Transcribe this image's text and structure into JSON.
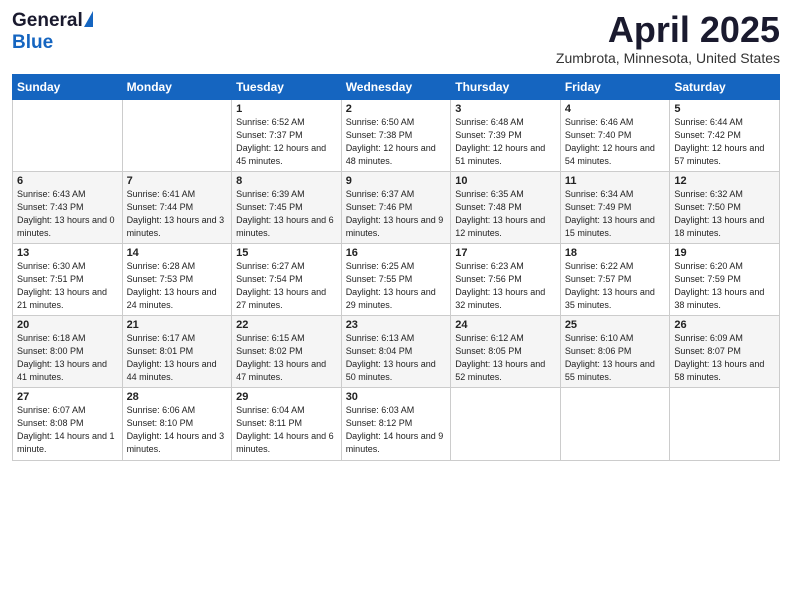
{
  "logo": {
    "general": "General",
    "blue": "Blue"
  },
  "title": "April 2025",
  "subtitle": "Zumbrota, Minnesota, United States",
  "weekdays": [
    "Sunday",
    "Monday",
    "Tuesday",
    "Wednesday",
    "Thursday",
    "Friday",
    "Saturday"
  ],
  "weeks": [
    [
      {
        "day": "",
        "sunrise": "",
        "sunset": "",
        "daylight": ""
      },
      {
        "day": "",
        "sunrise": "",
        "sunset": "",
        "daylight": ""
      },
      {
        "day": "1",
        "sunrise": "Sunrise: 6:52 AM",
        "sunset": "Sunset: 7:37 PM",
        "daylight": "Daylight: 12 hours and 45 minutes."
      },
      {
        "day": "2",
        "sunrise": "Sunrise: 6:50 AM",
        "sunset": "Sunset: 7:38 PM",
        "daylight": "Daylight: 12 hours and 48 minutes."
      },
      {
        "day": "3",
        "sunrise": "Sunrise: 6:48 AM",
        "sunset": "Sunset: 7:39 PM",
        "daylight": "Daylight: 12 hours and 51 minutes."
      },
      {
        "day": "4",
        "sunrise": "Sunrise: 6:46 AM",
        "sunset": "Sunset: 7:40 PM",
        "daylight": "Daylight: 12 hours and 54 minutes."
      },
      {
        "day": "5",
        "sunrise": "Sunrise: 6:44 AM",
        "sunset": "Sunset: 7:42 PM",
        "daylight": "Daylight: 12 hours and 57 minutes."
      }
    ],
    [
      {
        "day": "6",
        "sunrise": "Sunrise: 6:43 AM",
        "sunset": "Sunset: 7:43 PM",
        "daylight": "Daylight: 13 hours and 0 minutes."
      },
      {
        "day": "7",
        "sunrise": "Sunrise: 6:41 AM",
        "sunset": "Sunset: 7:44 PM",
        "daylight": "Daylight: 13 hours and 3 minutes."
      },
      {
        "day": "8",
        "sunrise": "Sunrise: 6:39 AM",
        "sunset": "Sunset: 7:45 PM",
        "daylight": "Daylight: 13 hours and 6 minutes."
      },
      {
        "day": "9",
        "sunrise": "Sunrise: 6:37 AM",
        "sunset": "Sunset: 7:46 PM",
        "daylight": "Daylight: 13 hours and 9 minutes."
      },
      {
        "day": "10",
        "sunrise": "Sunrise: 6:35 AM",
        "sunset": "Sunset: 7:48 PM",
        "daylight": "Daylight: 13 hours and 12 minutes."
      },
      {
        "day": "11",
        "sunrise": "Sunrise: 6:34 AM",
        "sunset": "Sunset: 7:49 PM",
        "daylight": "Daylight: 13 hours and 15 minutes."
      },
      {
        "day": "12",
        "sunrise": "Sunrise: 6:32 AM",
        "sunset": "Sunset: 7:50 PM",
        "daylight": "Daylight: 13 hours and 18 minutes."
      }
    ],
    [
      {
        "day": "13",
        "sunrise": "Sunrise: 6:30 AM",
        "sunset": "Sunset: 7:51 PM",
        "daylight": "Daylight: 13 hours and 21 minutes."
      },
      {
        "day": "14",
        "sunrise": "Sunrise: 6:28 AM",
        "sunset": "Sunset: 7:53 PM",
        "daylight": "Daylight: 13 hours and 24 minutes."
      },
      {
        "day": "15",
        "sunrise": "Sunrise: 6:27 AM",
        "sunset": "Sunset: 7:54 PM",
        "daylight": "Daylight: 13 hours and 27 minutes."
      },
      {
        "day": "16",
        "sunrise": "Sunrise: 6:25 AM",
        "sunset": "Sunset: 7:55 PM",
        "daylight": "Daylight: 13 hours and 29 minutes."
      },
      {
        "day": "17",
        "sunrise": "Sunrise: 6:23 AM",
        "sunset": "Sunset: 7:56 PM",
        "daylight": "Daylight: 13 hours and 32 minutes."
      },
      {
        "day": "18",
        "sunrise": "Sunrise: 6:22 AM",
        "sunset": "Sunset: 7:57 PM",
        "daylight": "Daylight: 13 hours and 35 minutes."
      },
      {
        "day": "19",
        "sunrise": "Sunrise: 6:20 AM",
        "sunset": "Sunset: 7:59 PM",
        "daylight": "Daylight: 13 hours and 38 minutes."
      }
    ],
    [
      {
        "day": "20",
        "sunrise": "Sunrise: 6:18 AM",
        "sunset": "Sunset: 8:00 PM",
        "daylight": "Daylight: 13 hours and 41 minutes."
      },
      {
        "day": "21",
        "sunrise": "Sunrise: 6:17 AM",
        "sunset": "Sunset: 8:01 PM",
        "daylight": "Daylight: 13 hours and 44 minutes."
      },
      {
        "day": "22",
        "sunrise": "Sunrise: 6:15 AM",
        "sunset": "Sunset: 8:02 PM",
        "daylight": "Daylight: 13 hours and 47 minutes."
      },
      {
        "day": "23",
        "sunrise": "Sunrise: 6:13 AM",
        "sunset": "Sunset: 8:04 PM",
        "daylight": "Daylight: 13 hours and 50 minutes."
      },
      {
        "day": "24",
        "sunrise": "Sunrise: 6:12 AM",
        "sunset": "Sunset: 8:05 PM",
        "daylight": "Daylight: 13 hours and 52 minutes."
      },
      {
        "day": "25",
        "sunrise": "Sunrise: 6:10 AM",
        "sunset": "Sunset: 8:06 PM",
        "daylight": "Daylight: 13 hours and 55 minutes."
      },
      {
        "day": "26",
        "sunrise": "Sunrise: 6:09 AM",
        "sunset": "Sunset: 8:07 PM",
        "daylight": "Daylight: 13 hours and 58 minutes."
      }
    ],
    [
      {
        "day": "27",
        "sunrise": "Sunrise: 6:07 AM",
        "sunset": "Sunset: 8:08 PM",
        "daylight": "Daylight: 14 hours and 1 minute."
      },
      {
        "day": "28",
        "sunrise": "Sunrise: 6:06 AM",
        "sunset": "Sunset: 8:10 PM",
        "daylight": "Daylight: 14 hours and 3 minutes."
      },
      {
        "day": "29",
        "sunrise": "Sunrise: 6:04 AM",
        "sunset": "Sunset: 8:11 PM",
        "daylight": "Daylight: 14 hours and 6 minutes."
      },
      {
        "day": "30",
        "sunrise": "Sunrise: 6:03 AM",
        "sunset": "Sunset: 8:12 PM",
        "daylight": "Daylight: 14 hours and 9 minutes."
      },
      {
        "day": "",
        "sunrise": "",
        "sunset": "",
        "daylight": ""
      },
      {
        "day": "",
        "sunrise": "",
        "sunset": "",
        "daylight": ""
      },
      {
        "day": "",
        "sunrise": "",
        "sunset": "",
        "daylight": ""
      }
    ]
  ]
}
